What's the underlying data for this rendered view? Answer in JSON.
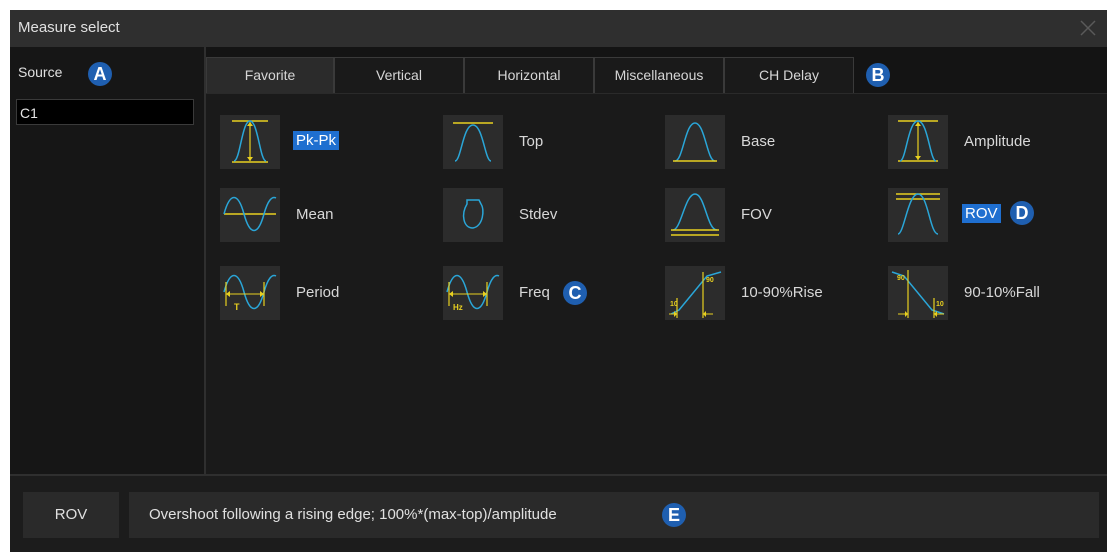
{
  "window": {
    "title": "Measure select"
  },
  "source": {
    "label": "Source",
    "value": "C1"
  },
  "callouts": {
    "a": "A",
    "b": "B",
    "c": "C",
    "d": "D",
    "e": "E"
  },
  "tabs": [
    {
      "label": "Favorite",
      "active": true
    },
    {
      "label": "Vertical",
      "active": false
    },
    {
      "label": "Horizontal",
      "active": false
    },
    {
      "label": "Miscellaneous",
      "active": false
    },
    {
      "label": "CH Delay",
      "active": false
    }
  ],
  "measurements": [
    {
      "label": "Pk-Pk",
      "icon": "pk-pk-icon",
      "selected": true
    },
    {
      "label": "Top",
      "icon": "top-icon",
      "selected": false
    },
    {
      "label": "Base",
      "icon": "base-icon",
      "selected": false
    },
    {
      "label": "Amplitude",
      "icon": "amplitude-icon",
      "selected": false
    },
    {
      "label": "Mean",
      "icon": "mean-icon",
      "selected": false
    },
    {
      "label": "Stdev",
      "icon": "stdev-icon",
      "selected": false
    },
    {
      "label": "FOV",
      "icon": "fov-icon",
      "selected": false
    },
    {
      "label": "ROV",
      "icon": "rov-icon",
      "selected": true
    },
    {
      "label": "Period",
      "icon": "period-icon",
      "selected": false
    },
    {
      "label": "Freq",
      "icon": "freq-icon",
      "selected": false
    },
    {
      "label": "10-90%Rise",
      "icon": "rise-icon",
      "selected": false
    },
    {
      "label": "90-10%Fall",
      "icon": "fall-icon",
      "selected": false
    }
  ],
  "icon_text": {
    "period_t": "T",
    "freq_hz": "Hz",
    "pct10": "10",
    "pct90": "90"
  },
  "description": {
    "name": "ROV",
    "text": "Overshoot following a rising edge; 100%*(max-top)/amplitude"
  },
  "colors": {
    "waveform": "#2aa6d8",
    "marker": "#e8d020",
    "selected": "#1f6fd0",
    "badge": "#1f5fb0"
  }
}
